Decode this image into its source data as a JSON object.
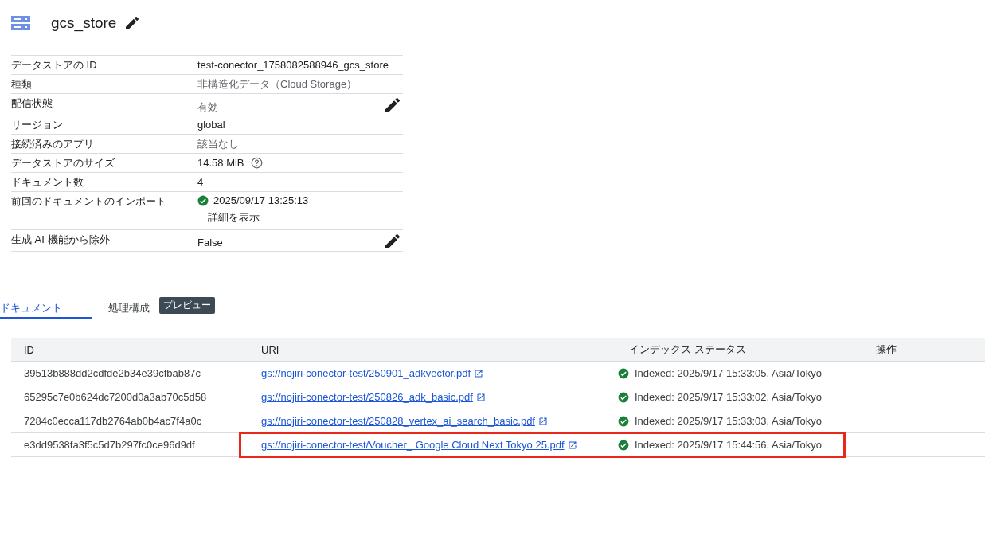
{
  "title": "gcs_store",
  "details": [
    {
      "label": "データストアの ID",
      "value": "test-conector_1758082588946_gcs_store",
      "muted": false,
      "editable": false,
      "kind": "text"
    },
    {
      "label": "種類",
      "value": "非構造化データ（Cloud Storage）",
      "muted": true,
      "editable": false,
      "kind": "text"
    },
    {
      "label": "配信状態",
      "value": "有効",
      "muted": true,
      "editable": true,
      "kind": "text"
    },
    {
      "label": "リージョン",
      "value": "global",
      "muted": false,
      "editable": false,
      "kind": "text"
    },
    {
      "label": "接続済みのアプリ",
      "value": "該当なし",
      "muted": true,
      "editable": false,
      "kind": "text"
    },
    {
      "label": "データストアのサイズ",
      "value": "14.58 MiB",
      "muted": false,
      "editable": false,
      "kind": "help"
    },
    {
      "label": "ドキュメント数",
      "value": "4",
      "muted": false,
      "editable": false,
      "kind": "text"
    },
    {
      "label": "前回のドキュメントのインポート",
      "value": "2025/09/17 13:25:13",
      "link": "詳細を表示",
      "muted": false,
      "editable": false,
      "kind": "status"
    },
    {
      "label": "生成 AI 機能から除外",
      "value": "False",
      "muted": false,
      "editable": true,
      "kind": "text"
    }
  ],
  "tabs": [
    {
      "label": "ドキュメント",
      "selected": true
    },
    {
      "label": "処理構成",
      "badge": "プレビュー",
      "selected": false
    }
  ],
  "table": {
    "columns": [
      "ID",
      "URI",
      "インデックス ステータス",
      "操作"
    ],
    "rows": [
      {
        "id": "39513b888dd2cdfde2b34e39cfbab87c",
        "uri": "gs://nojiri-conector-test/250901_adkvector.pdf",
        "status": "Indexed: 2025/9/17 15:33:05, Asia/Tokyo",
        "highlighted": false
      },
      {
        "id": "65295c7e0b624dc7200d0a3ab70c5d58",
        "uri": "gs://nojiri-conector-test/250826_adk_basic.pdf",
        "status": "Indexed: 2025/9/17 15:33:02, Asia/Tokyo",
        "highlighted": false
      },
      {
        "id": "7284c0ecca117db2764ab0b4ac7f4a0c",
        "uri": "gs://nojiri-conector-test/250828_vertex_ai_search_basic.pdf",
        "status": "Indexed: 2025/9/17 15:33:03, Asia/Tokyo",
        "highlighted": false
      },
      {
        "id": "e3dd9538fa3f5c5d7b297fc0ce96d9df",
        "uri": "gs://nojiri-conector-test/Voucher_ Google Cloud Next Tokyo 25.pdf",
        "status": "Indexed: 2025/9/17 15:44:56, Asia/Tokyo",
        "highlighted": true
      }
    ]
  }
}
